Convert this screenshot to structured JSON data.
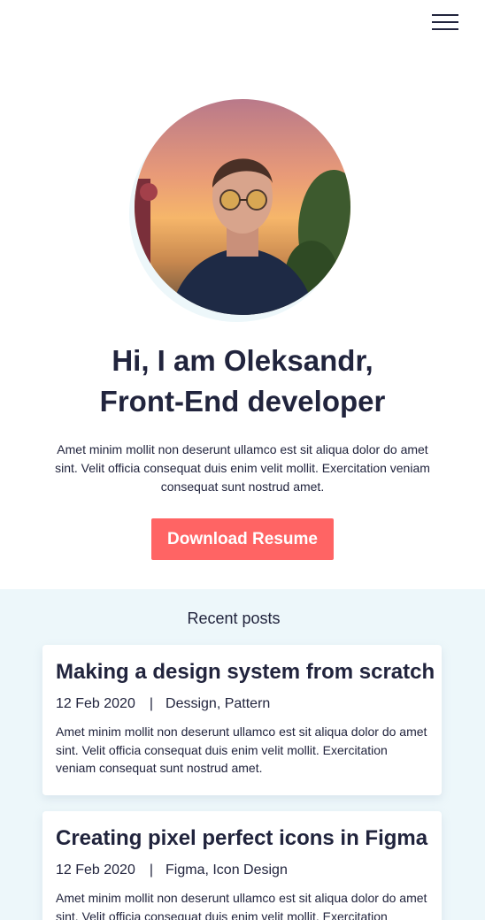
{
  "header": {
    "menu_icon": "hamburger-menu-icon"
  },
  "hero": {
    "avatar_alt": "avatar-photo",
    "title_line1": "Hi, I am Oleksandr,",
    "title_line2": "Front-End developer",
    "description": "Amet minim mollit non deserunt ullamco est sit aliqua dolor do amet sint. Velit officia consequat duis enim velit mollit. Exercitation veniam consequat sunt nostrud amet.",
    "button_label": "Download Resume"
  },
  "recent_posts": {
    "heading": "Recent posts",
    "posts": [
      {
        "title": "Making a design system from scratch",
        "date": "12 Feb 2020",
        "separator": "|",
        "tags": "Dessign, Pattern",
        "excerpt": "Amet minim mollit non deserunt ullamco est sit aliqua dolor do amet sint. Velit officia consequat duis enim velit mollit. Exercitation veniam consequat sunt nostrud amet."
      },
      {
        "title": "Creating pixel perfect icons in Figma",
        "date": "12 Feb 2020",
        "separator": "|",
        "tags": "Figma, Icon Design",
        "excerpt": "Amet minim mollit non deserunt ullamco est sit aliqua dolor do amet sint. Velit officia consequat duis enim velit mollit. Exercitation veniam consequat sunt nostrud amet."
      }
    ]
  },
  "colors": {
    "accent": "#FF6464",
    "text": "#21243D",
    "section_bg": "#EDF7FA"
  }
}
